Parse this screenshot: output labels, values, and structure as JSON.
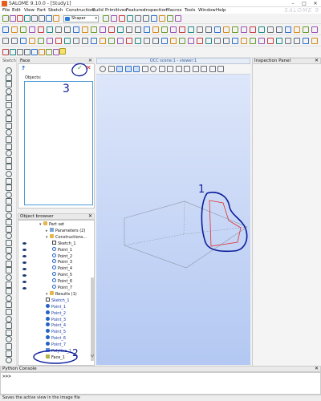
{
  "window": {
    "title": "SALOME 9.10.0 - [Study1]",
    "logo_text": "SALOME 9"
  },
  "menu": [
    "File",
    "Edit",
    "View",
    "Part",
    "Sketch",
    "Construction",
    "Build",
    "Primitives",
    "Features",
    "Inspection",
    "Macros",
    "Tools",
    "Window",
    "Help"
  ],
  "toolbar": {
    "module_label": "Shaper"
  },
  "left_toolbar": {
    "label": "Sketch"
  },
  "face_panel": {
    "title": "Face",
    "objects_label": "Objects:",
    "help_icon": "?",
    "ok_icon": "✓",
    "cancel_icon": "✕"
  },
  "object_browser": {
    "title": "Object browser",
    "rows": [
      {
        "label": "Part set",
        "icon": "folder",
        "indent": 0
      },
      {
        "label": "Parameters (2)",
        "icon": "param",
        "indent": 1
      },
      {
        "label": "Constructions...",
        "icon": "folder",
        "indent": 1
      },
      {
        "label": "Sketch_1",
        "icon": "sketch",
        "indent": 2
      },
      {
        "label": "Point_1",
        "icon": "point",
        "indent": 2
      },
      {
        "label": "Point_2",
        "icon": "point",
        "indent": 2
      },
      {
        "label": "Point_3",
        "icon": "point",
        "indent": 2
      },
      {
        "label": "Point_4",
        "icon": "point",
        "indent": 2
      },
      {
        "label": "Point_5",
        "icon": "point",
        "indent": 2
      },
      {
        "label": "Point_6",
        "icon": "point",
        "indent": 2
      },
      {
        "label": "Point_7",
        "icon": "point",
        "indent": 2
      },
      {
        "label": "Results (1)",
        "icon": "folder",
        "indent": 1
      },
      {
        "label": "Sketch_1",
        "icon": "sketch",
        "indent": 1
      },
      {
        "label": "Point_1",
        "icon": "point-blue",
        "indent": 1
      },
      {
        "label": "Point_2",
        "icon": "point-blue",
        "indent": 1
      },
      {
        "label": "Point_3",
        "icon": "point-blue",
        "indent": 1
      },
      {
        "label": "Point_4",
        "icon": "point-blue",
        "indent": 1
      },
      {
        "label": "Point_5",
        "icon": "point-blue",
        "indent": 1
      },
      {
        "label": "Point_6",
        "icon": "point-blue",
        "indent": 1
      },
      {
        "label": "Point_7",
        "icon": "point-blue",
        "indent": 1
      },
      {
        "label": "Polyline_1",
        "icon": "poly",
        "indent": 1
      },
      {
        "label": "Face_1",
        "icon": "face",
        "indent": 1
      }
    ]
  },
  "viewer": {
    "title": "OCC scene:1 - viewer:1"
  },
  "inspection_panel": {
    "title": "Inspection Panel"
  },
  "python_console": {
    "title": "Python Console",
    "prompt": ">>>"
  },
  "status_bar": {
    "text": "Saves the active view in the image file"
  },
  "annotations": {
    "n1": "1",
    "n2": "2",
    "n3": "3"
  }
}
